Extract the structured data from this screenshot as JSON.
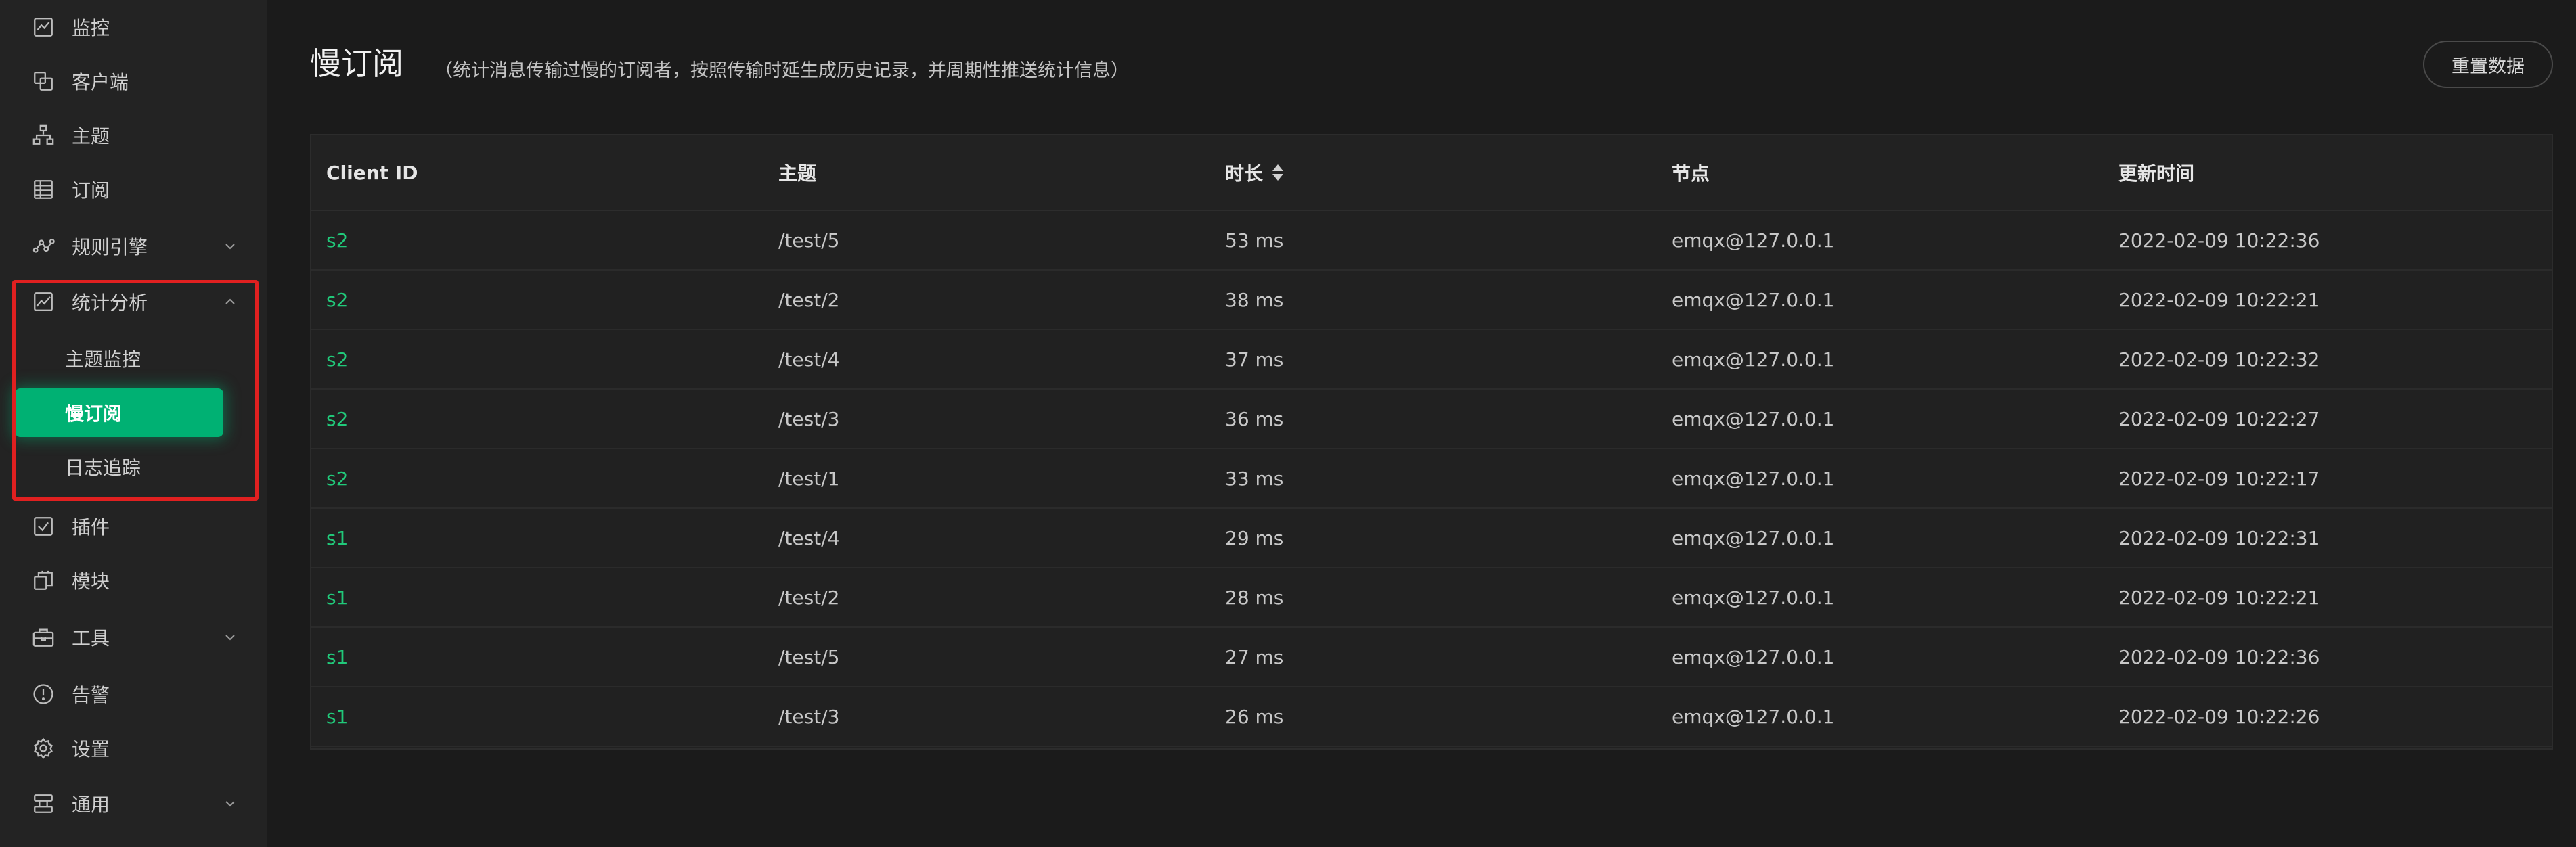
{
  "sidebar": {
    "items": [
      {
        "label": "监控",
        "icon": "monitor-chart-icon"
      },
      {
        "label": "客户端",
        "icon": "clients-icon"
      },
      {
        "label": "主题",
        "icon": "topic-tree-icon"
      },
      {
        "label": "订阅",
        "icon": "subscription-table-icon"
      },
      {
        "label": "规则引擎",
        "icon": "rule-engine-icon",
        "expandable": true
      },
      {
        "label": "统计分析",
        "icon": "analytics-chart-icon",
        "expandable": true,
        "expanded": true
      },
      {
        "label": "插件",
        "icon": "plugin-checkbox-icon"
      },
      {
        "label": "模块",
        "icon": "modules-icon"
      },
      {
        "label": "工具",
        "icon": "toolbox-icon",
        "expandable": true
      },
      {
        "label": "告警",
        "icon": "alert-circle-icon"
      },
      {
        "label": "设置",
        "icon": "gear-icon"
      },
      {
        "label": "通用",
        "icon": "general-icon",
        "expandable": true
      }
    ],
    "analytics_sub_items": [
      {
        "label": "主题监控",
        "active": false
      },
      {
        "label": "慢订阅",
        "active": true
      },
      {
        "label": "日志追踪",
        "active": false
      }
    ]
  },
  "page": {
    "title": "慢订阅",
    "description": "（统计消息传输过慢的订阅者，按照传输时延生成历史记录，并周期性推送统计信息）",
    "reset_button": "重置数据"
  },
  "table": {
    "columns": [
      "Client ID",
      "主题",
      "时长",
      "节点",
      "更新时间"
    ],
    "sortable_column": "时长",
    "rows": [
      {
        "client_id": "s2",
        "topic": "/test/5",
        "duration": "53 ms",
        "node": "emqx@127.0.0.1",
        "updated": "2022-02-09 10:22:36"
      },
      {
        "client_id": "s2",
        "topic": "/test/2",
        "duration": "38 ms",
        "node": "emqx@127.0.0.1",
        "updated": "2022-02-09 10:22:21"
      },
      {
        "client_id": "s2",
        "topic": "/test/4",
        "duration": "37 ms",
        "node": "emqx@127.0.0.1",
        "updated": "2022-02-09 10:22:32"
      },
      {
        "client_id": "s2",
        "topic": "/test/3",
        "duration": "36 ms",
        "node": "emqx@127.0.0.1",
        "updated": "2022-02-09 10:22:27"
      },
      {
        "client_id": "s2",
        "topic": "/test/1",
        "duration": "33 ms",
        "node": "emqx@127.0.0.1",
        "updated": "2022-02-09 10:22:17"
      },
      {
        "client_id": "s1",
        "topic": "/test/4",
        "duration": "29 ms",
        "node": "emqx@127.0.0.1",
        "updated": "2022-02-09 10:22:31"
      },
      {
        "client_id": "s1",
        "topic": "/test/2",
        "duration": "28 ms",
        "node": "emqx@127.0.0.1",
        "updated": "2022-02-09 10:22:21"
      },
      {
        "client_id": "s1",
        "topic": "/test/5",
        "duration": "27 ms",
        "node": "emqx@127.0.0.1",
        "updated": "2022-02-09 10:22:36"
      },
      {
        "client_id": "s1",
        "topic": "/test/3",
        "duration": "26 ms",
        "node": "emqx@127.0.0.1",
        "updated": "2022-02-09 10:22:26"
      }
    ]
  },
  "colors": {
    "accent_green": "#00b173",
    "link_green": "#21c97a",
    "highlight_red": "#e02020",
    "background": "#1b1b1b",
    "sidebar": "#232323"
  }
}
